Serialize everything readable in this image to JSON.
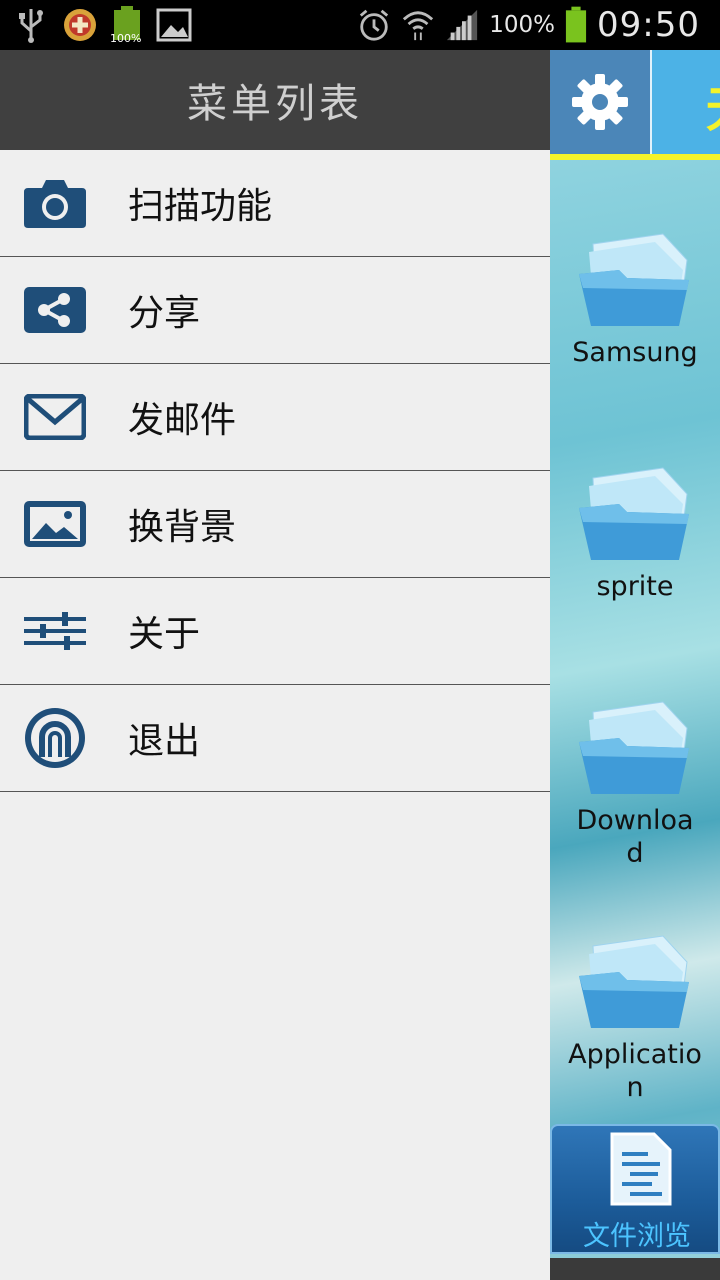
{
  "status_bar": {
    "icons_left": [
      "usb-icon",
      "app-notification-icon",
      "battery-full-notification-icon",
      "image-icon"
    ],
    "battery_mini_label": "100%",
    "icons_right": [
      "alarm-icon",
      "wifi-icon",
      "signal-icon",
      "battery-icon"
    ],
    "battery_percent": "100%",
    "time": "09:50"
  },
  "drawer": {
    "title": "菜单列表",
    "items": [
      {
        "label": "扫描功能",
        "icon": "camera-icon"
      },
      {
        "label": "分享",
        "icon": "share-icon"
      },
      {
        "label": "发邮件",
        "icon": "mail-icon"
      },
      {
        "label": "换背景",
        "icon": "picture-icon"
      },
      {
        "label": "关于",
        "icon": "sliders-icon"
      },
      {
        "label": "退出",
        "icon": "power-icon"
      }
    ]
  },
  "main": {
    "settings_icon": "gear-icon",
    "tab_partial_char": "无",
    "folders": [
      {
        "label": "Samsung"
      },
      {
        "label": "sprite"
      },
      {
        "label": "Download"
      },
      {
        "label": "Application"
      }
    ],
    "bottom_tab": {
      "label": "文件浏览",
      "icon": "document-icon"
    }
  },
  "colors": {
    "drawer_bg": "#efefef",
    "drawer_header": "#404040",
    "icon_blue": "#1f4e79",
    "accent_yellow": "#f4f32a",
    "topbar_blue": "#4cb2e6",
    "tab_label": "#4cc4ff"
  }
}
